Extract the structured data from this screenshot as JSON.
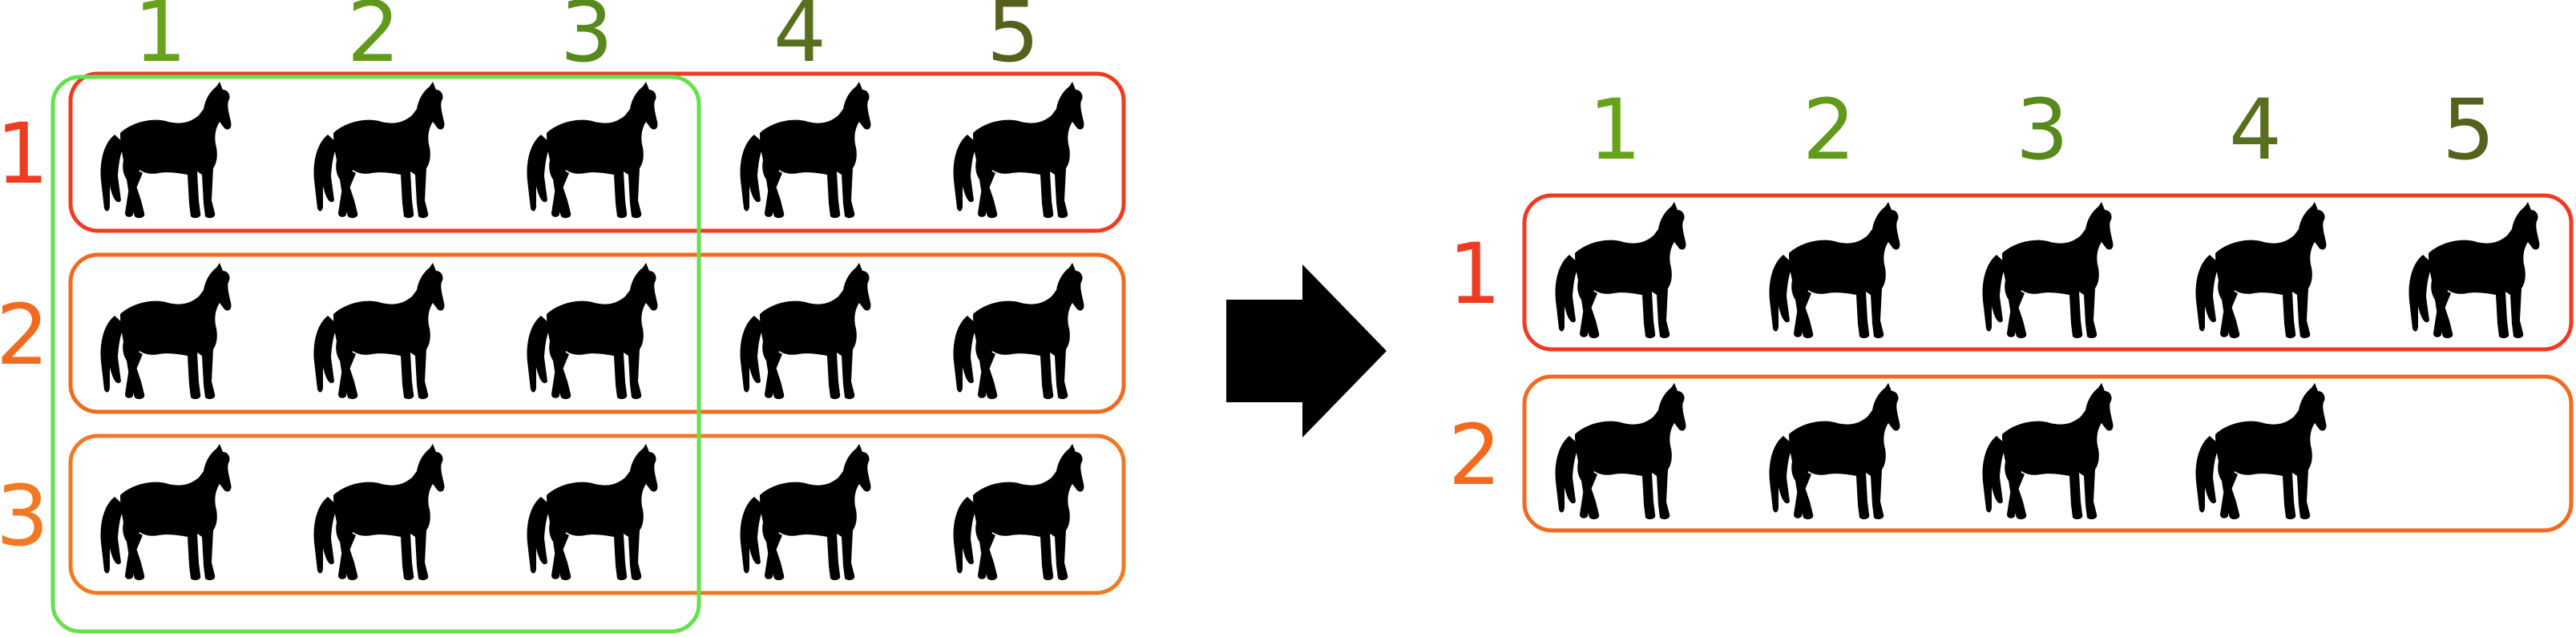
{
  "colors": {
    "background": "#ffffff",
    "horse": "#000000",
    "arrow": "#000000",
    "column_selection_box": "#66e04c",
    "row_box_1": "#ee3b22",
    "row_box_2": "#f26a1f",
    "row_box_3": "#f07a24",
    "col_label_1": "#66a319",
    "col_label_2": "#5f9a1a",
    "col_label_3": "#57891c",
    "col_label_4": "#576f1e",
    "col_label_5": "#58601e",
    "row_label_1": "#ee3b22",
    "row_label_2": "#f26a1f",
    "row_label_3": "#f07a24"
  },
  "icons": {
    "animal": "horse-silhouette-icon",
    "transition": "right-arrow-icon"
  },
  "left_grid": {
    "column_labels": [
      "1",
      "2",
      "3",
      "4",
      "5"
    ],
    "row_labels": [
      "1",
      "2",
      "3"
    ],
    "rows": 3,
    "columns": 5,
    "selected_columns": 3
  },
  "right_grid": {
    "column_labels": [
      "1",
      "2",
      "3",
      "4",
      "5"
    ],
    "row_labels": [
      "1",
      "2"
    ],
    "row_counts": [
      5,
      4
    ]
  }
}
